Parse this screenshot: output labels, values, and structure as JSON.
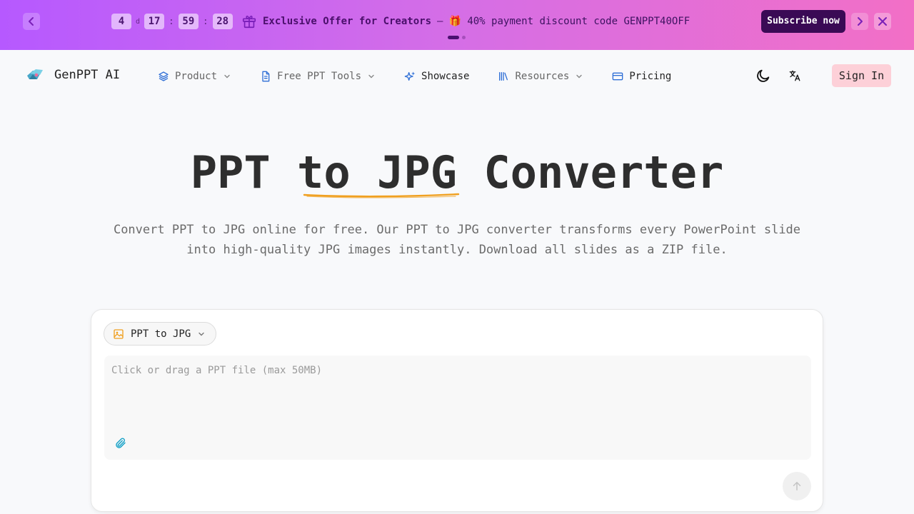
{
  "colors": {
    "banner_gradient": [
      "#b659ff",
      "#f26fc6"
    ],
    "subscribe_bg": "#3a0a55",
    "signin_bg": "#fdd0d8",
    "underline": "#f0a020",
    "accent_blue": "#2f6fd6"
  },
  "promo": {
    "countdown": {
      "days": "4",
      "days_unit": "d",
      "hours": "17",
      "minutes": "59",
      "seconds": "28",
      "sep": ":"
    },
    "title": "Exclusive Offer for Creators",
    "dash": "—",
    "detail": "🎁 40% payment discount code GENPPT40OFF",
    "subscribe_label": "Subscribe now",
    "prev_icon": "chevron-left",
    "next_icon": "chevron-right",
    "close_icon": "close"
  },
  "header": {
    "brand": "GenPPT AI",
    "menu": [
      {
        "label": "Product",
        "icon": "layers-icon",
        "has_dropdown": true
      },
      {
        "label": "Free PPT Tools",
        "icon": "document-icon",
        "has_dropdown": true
      },
      {
        "label": "Showcase",
        "icon": "sparkles-icon",
        "has_dropdown": false
      },
      {
        "label": "Resources",
        "icon": "library-icon",
        "has_dropdown": true
      },
      {
        "label": "Pricing",
        "icon": "credit-card-icon",
        "has_dropdown": false
      }
    ],
    "theme_icon": "moon-icon",
    "language_icon": "translate-icon",
    "signin_label": "Sign In"
  },
  "hero": {
    "title_before": "PPT ",
    "title_highlight": "to JPG",
    "title_after": " Converter",
    "subtitle": "Convert PPT to JPG online for free. Our PPT to JPG converter transforms every PowerPoint slide into high-quality JPG images instantly. Download all slides as a ZIP file."
  },
  "converter": {
    "mode_label": "PPT to JPG",
    "mode_icon": "image-icon",
    "dropzone_placeholder": "Click or drag a PPT file (max 50MB)",
    "attach_icon": "paperclip-icon",
    "send_icon": "arrow-up-icon"
  }
}
